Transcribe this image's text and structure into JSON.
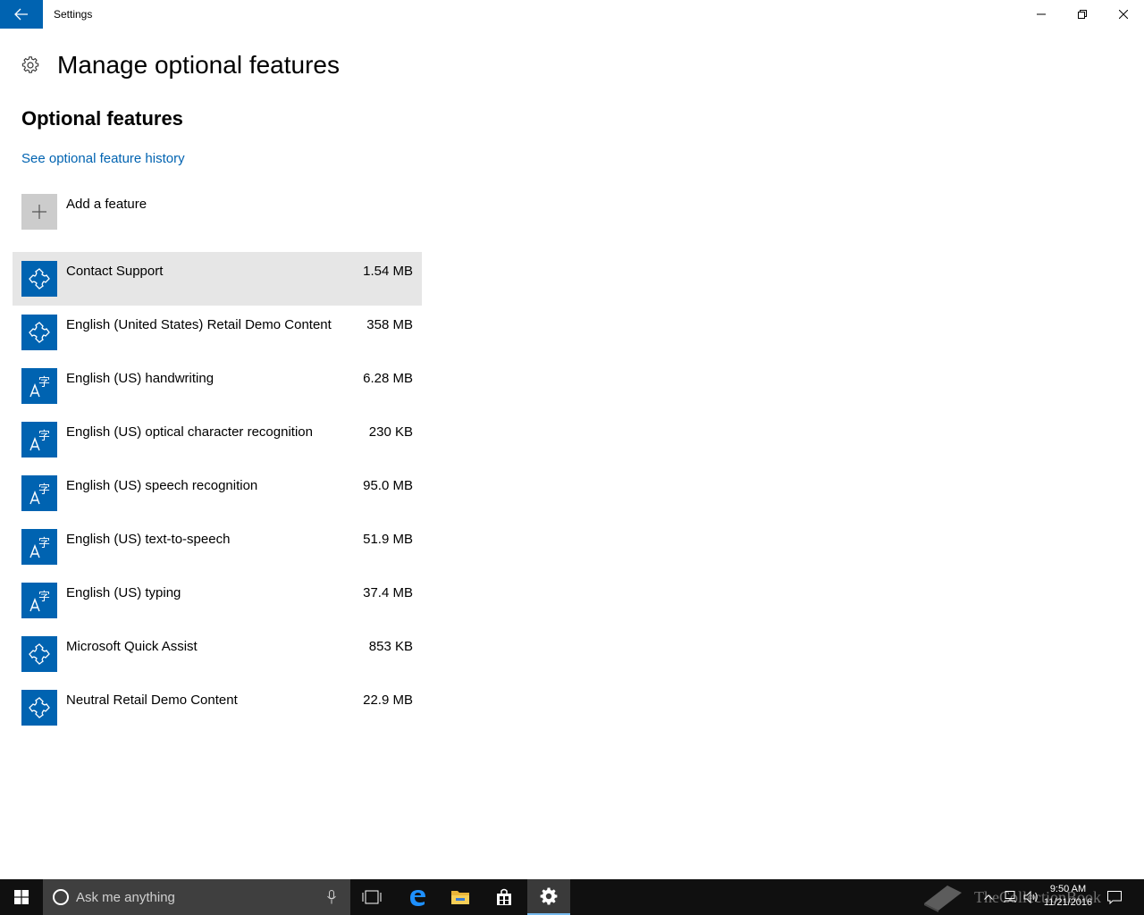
{
  "window": {
    "app_title": "Settings",
    "back_icon": "arrow-left-icon",
    "controls": [
      "minimize-icon",
      "restore-icon",
      "close-icon"
    ]
  },
  "header": {
    "title": "Manage optional features",
    "icon": "gear-icon"
  },
  "section": {
    "title": "Optional features",
    "history_link": "See optional feature history"
  },
  "add_feature": {
    "label": "Add a feature",
    "icon": "plus-icon"
  },
  "features": [
    {
      "name": "Contact Support",
      "size": "1.54 MB",
      "icon": "puzzle-icon",
      "selected": true
    },
    {
      "name": "English (United States) Retail Demo Content",
      "size": "358 MB",
      "icon": "puzzle-icon"
    },
    {
      "name": "English (US) handwriting",
      "size": "6.28 MB",
      "icon": "language-icon"
    },
    {
      "name": "English (US) optical character recognition",
      "size": "230 KB",
      "icon": "language-icon"
    },
    {
      "name": "English (US) speech recognition",
      "size": "95.0 MB",
      "icon": "language-icon"
    },
    {
      "name": "English (US) text-to-speech",
      "size": "51.9 MB",
      "icon": "language-icon"
    },
    {
      "name": "English (US) typing",
      "size": "37.4 MB",
      "icon": "language-icon"
    },
    {
      "name": "Microsoft Quick Assist",
      "size": "853 KB",
      "icon": "puzzle-icon"
    },
    {
      "name": "Neutral Retail Demo Content",
      "size": "22.9 MB",
      "icon": "puzzle-icon"
    }
  ],
  "taskbar": {
    "search_placeholder": "Ask me anything",
    "watermark": "TheCollectionBook",
    "clock_time": "9:50 AM",
    "clock_date": "11/21/2016"
  },
  "colors": {
    "accent": "#0063b1",
    "selected_row": "#e6e6e6",
    "taskbar": "#101010"
  }
}
